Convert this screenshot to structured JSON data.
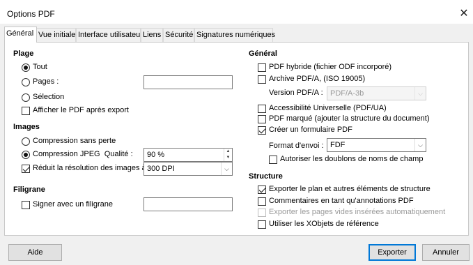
{
  "window": {
    "title": "Options PDF",
    "close_glyph": "✕"
  },
  "tabs": [
    {
      "label": "Général",
      "active": true
    },
    {
      "label": "Vue initiale",
      "active": false
    },
    {
      "label": "Interface utilisateur",
      "active": false
    },
    {
      "label": "Liens",
      "active": false
    },
    {
      "label": "Sécurité",
      "active": false
    },
    {
      "label": "Signatures numériques",
      "active": false
    }
  ],
  "plage": {
    "heading": "Plage",
    "tout": {
      "label": "Tout",
      "checked": true
    },
    "pages": {
      "label": "Pages :",
      "checked": false,
      "value": ""
    },
    "selection": {
      "label": "Sélection",
      "checked": false
    },
    "afficher": {
      "label": "Afficher le PDF après export",
      "checked": false
    }
  },
  "images": {
    "heading": "Images",
    "sans_perte": {
      "label": "Compression sans perte",
      "checked": false
    },
    "jpeg": {
      "label": "Compression JPEG  Qualité :",
      "checked": true,
      "value": "90 %"
    },
    "reduit": {
      "label": "Réduit la résolution des images à :",
      "checked": true,
      "value": "300 DPI"
    }
  },
  "filigrane": {
    "heading": "Filigrane",
    "signer": {
      "label": "Signer avec un filigrane",
      "checked": false,
      "value": ""
    }
  },
  "general": {
    "heading": "Général",
    "hybride": {
      "label": "PDF hybride (fichier ODF incorporé)",
      "checked": false
    },
    "archive": {
      "label": "Archive PDF/A, (ISO 19005)",
      "checked": false
    },
    "version": {
      "label": "Version PDF/A :",
      "value": "PDF/A-3b"
    },
    "accessibilite": {
      "label": "Accessibilité Universelle (PDF/UA)",
      "checked": false
    },
    "marque": {
      "label": "PDF marqué (ajouter la structure du document)",
      "checked": false
    },
    "formulaire": {
      "label": "Créer un formulaire PDF",
      "checked": true
    },
    "format": {
      "label": "Format d'envoi :",
      "value": "FDF"
    },
    "doublons": {
      "label": "Autoriser les doublons de noms de champ",
      "checked": false
    }
  },
  "structure": {
    "heading": "Structure",
    "plan": {
      "label": "Exporter le plan et autres éléments de structure",
      "checked": true
    },
    "commentaires": {
      "label": "Commentaires en tant qu'annotations PDF",
      "checked": false
    },
    "pages_vides": {
      "label": "Exporter les pages vides insérées automatiquement",
      "checked": false,
      "disabled": true
    },
    "xobjets": {
      "label": "Utiliser les XObjets de référence",
      "checked": false
    }
  },
  "buttons": {
    "aide": "Aide",
    "exporter": "Exporter",
    "annuler": "Annuler"
  }
}
